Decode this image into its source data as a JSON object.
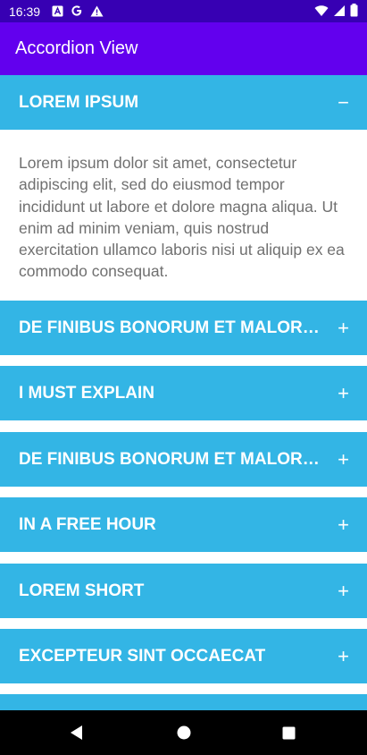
{
  "status_bar": {
    "time": "16:39",
    "left_icons": [
      "a-badge-icon",
      "google-icon",
      "warning-icon"
    ],
    "right_icons": [
      "wifi-icon",
      "cellular-signal-icon",
      "battery-icon"
    ]
  },
  "app_bar": {
    "title": "Accordion View"
  },
  "accordion": {
    "items": [
      {
        "title": "LOREM IPSUM",
        "sign": "−",
        "expanded": true,
        "body": "Lorem ipsum dolor sit amet, consectetur adipiscing elit, sed do eiusmod tempor incididunt ut labore et dolore magna aliqua. Ut enim ad minim veniam, quis nostrud exercitation ullamco laboris nisi ut aliquip ex ea commodo consequat."
      },
      {
        "title": "DE FINIBUS BONORUM ET MALORUM",
        "sign": "+",
        "expanded": false
      },
      {
        "title": "I MUST EXPLAIN",
        "sign": "+",
        "expanded": false
      },
      {
        "title": "DE FINIBUS BONORUM ET MALORUM",
        "sign": "+",
        "expanded": false
      },
      {
        "title": "IN A FREE HOUR",
        "sign": "+",
        "expanded": false
      },
      {
        "title": "LOREM SHORT",
        "sign": "+",
        "expanded": false
      },
      {
        "title": "EXCEPTEUR SINT OCCAECAT",
        "sign": "+",
        "expanded": false
      },
      {
        "title": "",
        "sign": "",
        "expanded": false
      }
    ]
  },
  "nav_bar": {
    "buttons": [
      "back-icon",
      "home-icon",
      "recents-icon"
    ]
  },
  "colors": {
    "status_bar": "#3700b3",
    "app_bar": "#6200ee",
    "accordion_header": "#33b5e5",
    "body_text": "#707070",
    "nav_bar": "#000000"
  }
}
